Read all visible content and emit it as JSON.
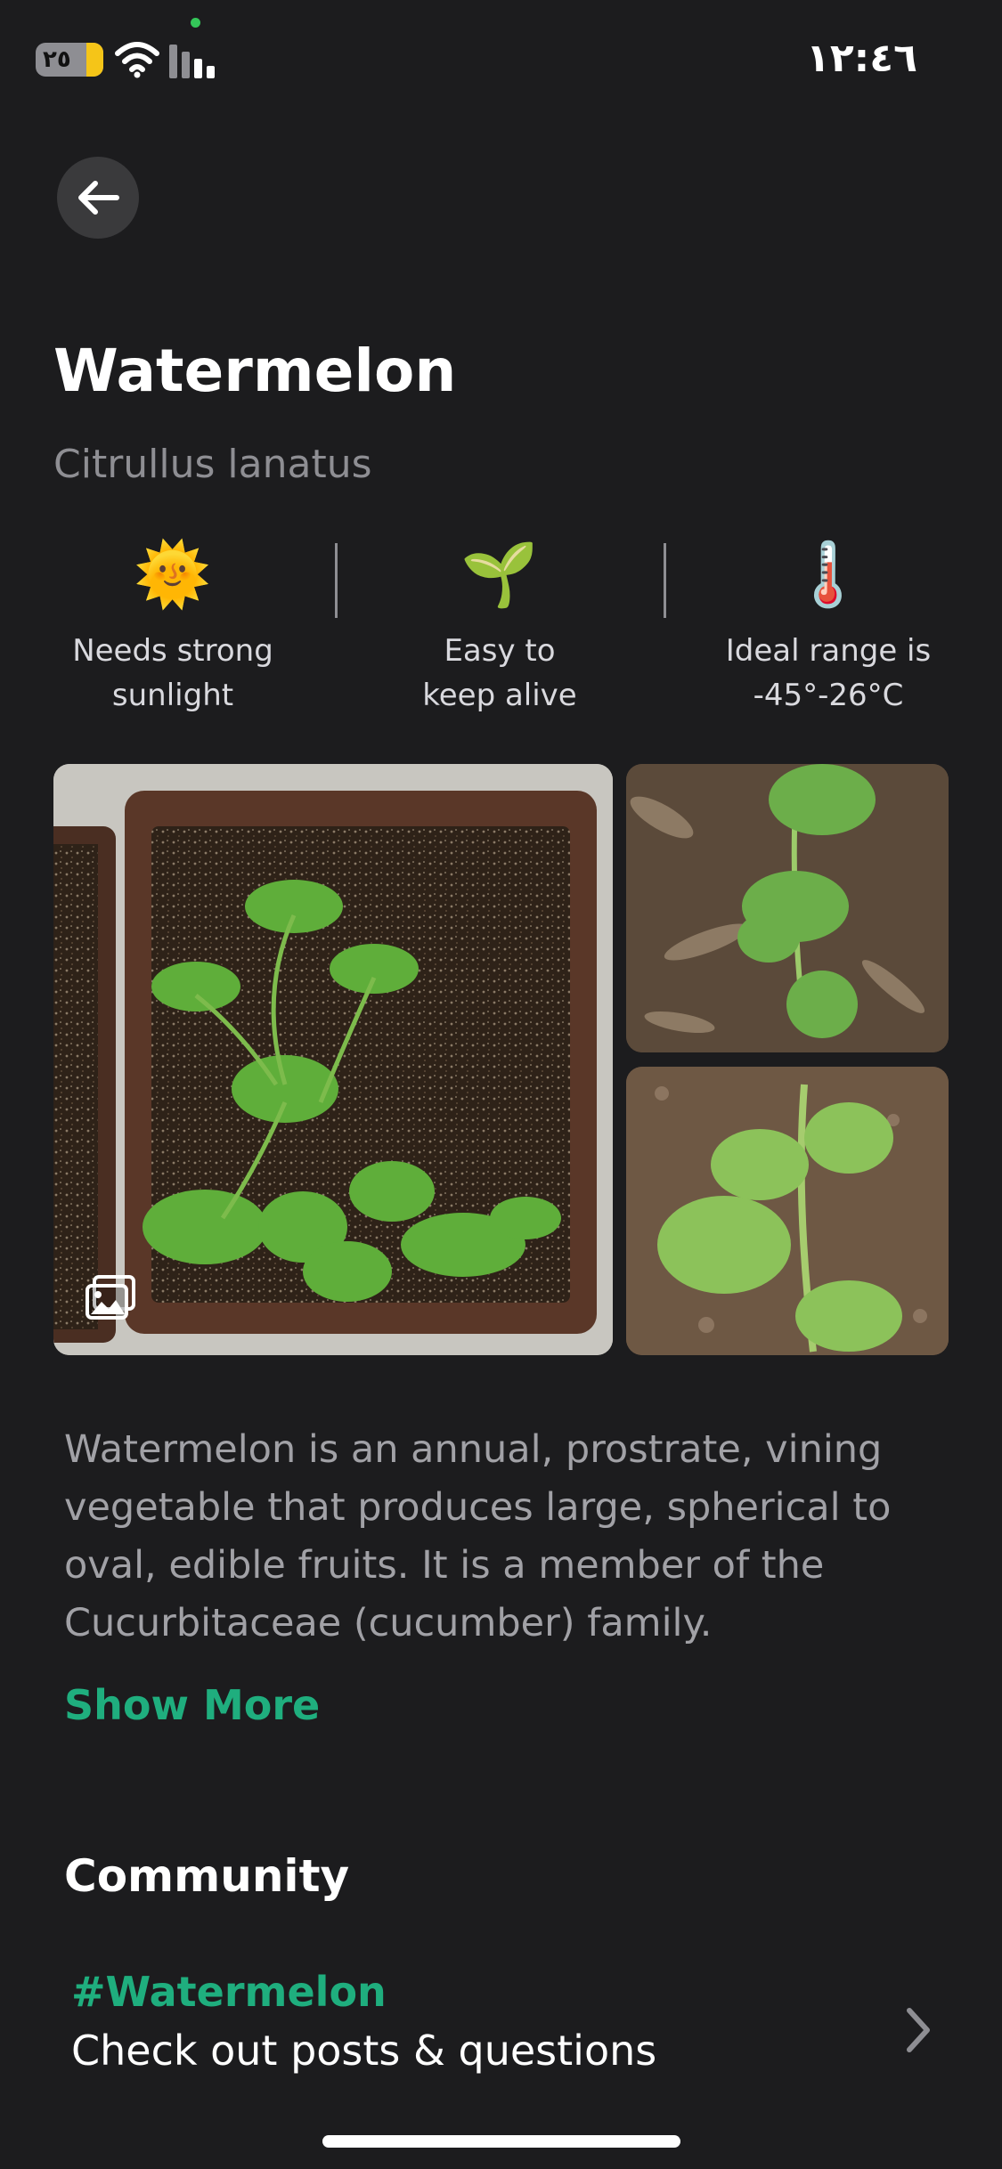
{
  "status_bar": {
    "time": "١٢:٤٦",
    "battery_label": "٢٥",
    "battery_level": 0.25
  },
  "plant": {
    "name": "Watermelon",
    "scientific_name": "Citrullus lanatus"
  },
  "care": [
    {
      "icon": "sun-icon",
      "emoji": "🌞",
      "line1": "Needs strong",
      "line2": "sunlight"
    },
    {
      "icon": "seedling-icon",
      "emoji": "🌱",
      "line1": "Easy to",
      "line2": "keep alive"
    },
    {
      "icon": "thermometer-icon",
      "emoji": "🌡️",
      "line1": "Ideal range is",
      "line2": "-45°-26°C"
    }
  ],
  "description": "Watermelon is an annual, prostrate, vining vegetable that produces large, spherical to oval, edible fruits. It is a member of the Cucurbitaceae (cucumber) family.",
  "show_more_label": "Show More",
  "community": {
    "title": "Community",
    "tag": "#Watermelon",
    "subtitle": "Check out posts & questions"
  },
  "colors": {
    "background": "#1c1c1e",
    "accent": "#1fae7e",
    "secondary_text": "#8e8e93"
  }
}
